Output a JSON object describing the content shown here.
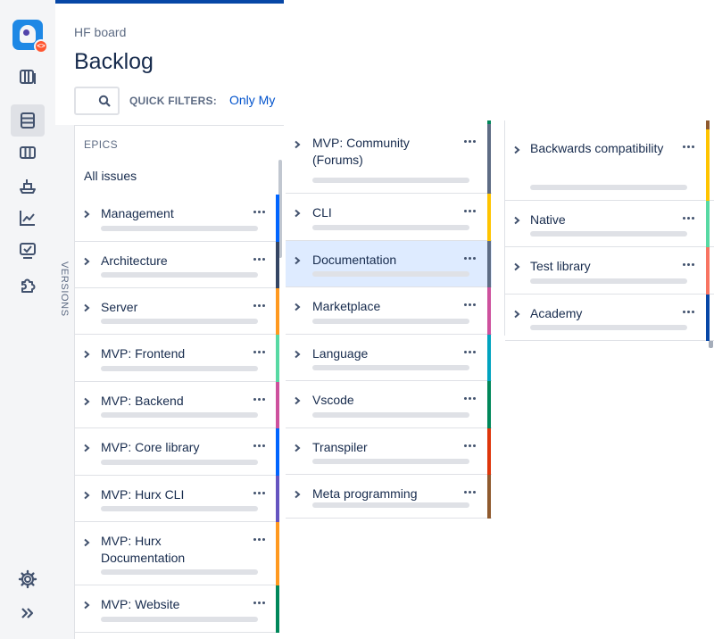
{
  "board": {
    "breadcrumb": "HF board",
    "title": "Backlog"
  },
  "filters": {
    "label": "QUICK FILTERS:",
    "only_my": "Only My"
  },
  "side_tab": {
    "versions": "VERSIONS"
  },
  "epics_panel": {
    "heading": "EPICS",
    "all_issues": "All issues"
  },
  "nav": [
    {
      "name": "roadmap-icon"
    },
    {
      "name": "backlog-icon",
      "active": true
    },
    {
      "name": "board-icon"
    },
    {
      "name": "releases-icon"
    },
    {
      "name": "reports-icon"
    },
    {
      "name": "issues-icon"
    },
    {
      "name": "addon-icon"
    },
    {
      "name": "settings-icon"
    },
    {
      "name": "expand-icon"
    }
  ],
  "columns": [
    [
      {
        "label": "Management",
        "color": "#0065ff"
      },
      {
        "label": "Architecture",
        "color": "#344563"
      },
      {
        "label": "Server",
        "color": "#ff991f"
      },
      {
        "label": "MVP: Frontend",
        "color": "#57d9a3"
      },
      {
        "label": "MVP: Backend",
        "color": "#cd519d"
      },
      {
        "label": "MVP: Core library",
        "color": "#0065ff"
      },
      {
        "label": "MVP: Hurx CLI",
        "color": "#6554c0"
      },
      {
        "label": "MVP: Hurx Documentation",
        "color": "#ff991f"
      },
      {
        "label": "MVP: Website",
        "color": "#00875a"
      }
    ],
    [
      {
        "label": "MVP: Community (Forums)",
        "color": "#5e6c84"
      },
      {
        "label": "CLI",
        "color": "#ffc400"
      },
      {
        "label": "Documentation",
        "color": "#5e6c84",
        "selected": true
      },
      {
        "label": "Marketplace",
        "color": "#cd519d"
      },
      {
        "label": "Language",
        "color": "#00a3bf"
      },
      {
        "label": "Vscode",
        "color": "#00875a"
      },
      {
        "label": "Transpiler",
        "color": "#de350b"
      },
      {
        "label": "Meta programming",
        "color": "#8f5a2e"
      }
    ],
    [
      {
        "label": "Backwards compatibility",
        "color": "#ffc400"
      },
      {
        "label": "Native",
        "color": "#57d9a3"
      },
      {
        "label": "Test library",
        "color": "#f87462"
      },
      {
        "label": "Academy",
        "color": "#0747a6"
      }
    ]
  ]
}
